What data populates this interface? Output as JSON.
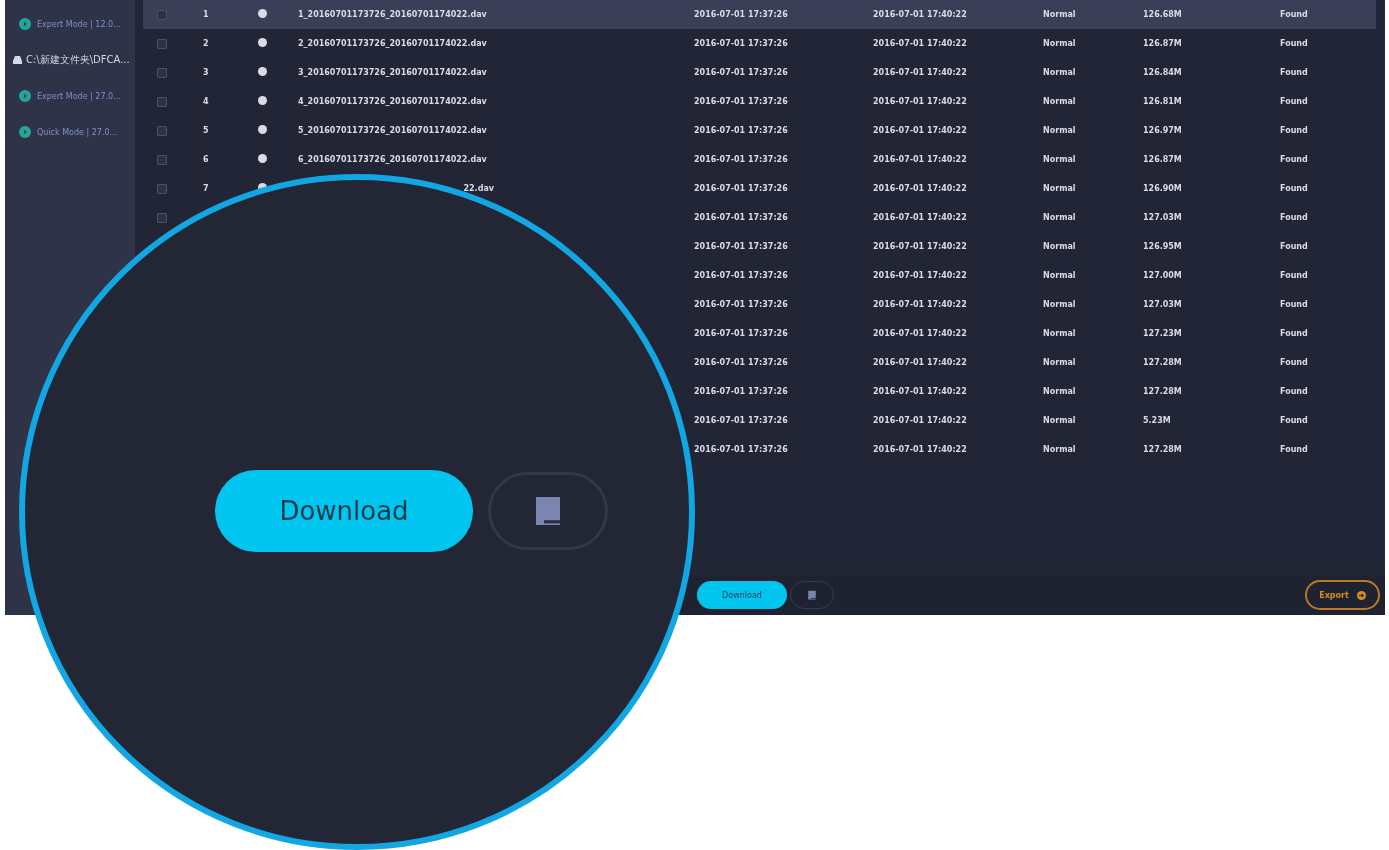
{
  "sidebar": {
    "items": [
      {
        "kind": "mode",
        "label": "Expert Mode | 12.0..."
      },
      {
        "kind": "drive",
        "label": "C:\\新建文件夹\\DFCA..."
      },
      {
        "kind": "mode",
        "label": "Expert Mode | 27.0..."
      },
      {
        "kind": "mode",
        "label": "Quick Mode | 27.0..."
      }
    ]
  },
  "table": {
    "rows": [
      {
        "selected": true,
        "checked": false,
        "number": "1",
        "name": "1_20160701173726_20160701174022.dav",
        "created": "2016-07-01 17:37:26",
        "modified": "2016-07-01 17:40:22",
        "type": "Normal",
        "size": "126.68M",
        "status": "Found"
      },
      {
        "selected": false,
        "checked": false,
        "number": "2",
        "name": "2_20160701173726_20160701174022.dav",
        "created": "2016-07-01 17:37:26",
        "modified": "2016-07-01 17:40:22",
        "type": "Normal",
        "size": "126.87M",
        "status": "Found"
      },
      {
        "selected": false,
        "checked": false,
        "number": "3",
        "name": "3_20160701173726_20160701174022.dav",
        "created": "2016-07-01 17:37:26",
        "modified": "2016-07-01 17:40:22",
        "type": "Normal",
        "size": "126.84M",
        "status": "Found"
      },
      {
        "selected": false,
        "checked": false,
        "number": "4",
        "name": "4_20160701173726_20160701174022.dav",
        "created": "2016-07-01 17:37:26",
        "modified": "2016-07-01 17:40:22",
        "type": "Normal",
        "size": "126.81M",
        "status": "Found"
      },
      {
        "selected": false,
        "checked": false,
        "number": "5",
        "name": "5_20160701173726_20160701174022.dav",
        "created": "2016-07-01 17:37:26",
        "modified": "2016-07-01 17:40:22",
        "type": "Normal",
        "size": "126.97M",
        "status": "Found"
      },
      {
        "selected": false,
        "checked": false,
        "number": "6",
        "name": "6_20160701173726_20160701174022.dav",
        "created": "2016-07-01 17:37:26",
        "modified": "2016-07-01 17:40:22",
        "type": "Normal",
        "size": "126.87M",
        "status": "Found"
      },
      {
        "selected": false,
        "checked": false,
        "number": "7",
        "name_tail": "22.dav",
        "created": "2016-07-01 17:37:26",
        "modified": "2016-07-01 17:40:22",
        "type": "Normal",
        "size": "126.90M",
        "status": "Found"
      },
      {
        "selected": false,
        "checked": false,
        "created": "2016-07-01 17:37:26",
        "modified": "2016-07-01 17:40:22",
        "type": "Normal",
        "size": "127.03M",
        "status": "Found"
      },
      {
        "selected": false,
        "created": "2016-07-01 17:37:26",
        "modified": "2016-07-01 17:40:22",
        "type": "Normal",
        "size": "126.95M",
        "status": "Found"
      },
      {
        "selected": false,
        "created": "2016-07-01 17:37:26",
        "modified": "2016-07-01 17:40:22",
        "type": "Normal",
        "size": "127.00M",
        "status": "Found"
      },
      {
        "selected": false,
        "created": "2016-07-01 17:37:26",
        "modified": "2016-07-01 17:40:22",
        "type": "Normal",
        "size": "127.03M",
        "status": "Found"
      },
      {
        "selected": false,
        "created": "2016-07-01 17:37:26",
        "modified": "2016-07-01 17:40:22",
        "type": "Normal",
        "size": "127.23M",
        "status": "Found"
      },
      {
        "selected": false,
        "created": "2016-07-01 17:37:26",
        "modified": "2016-07-01 17:40:22",
        "type": "Normal",
        "size": "127.28M",
        "status": "Found"
      },
      {
        "selected": false,
        "created": "2016-07-01 17:37:26",
        "modified": "2016-07-01 17:40:22",
        "type": "Normal",
        "size": "127.28M",
        "status": "Found"
      },
      {
        "selected": false,
        "created": "2016-07-01 17:37:26",
        "modified": "2016-07-01 17:40:22",
        "type": "Normal",
        "size": "5.23M",
        "status": "Found"
      },
      {
        "selected": false,
        "created": "2016-07-01 17:37:26",
        "modified": "2016-07-01 17:40:22",
        "type": "Normal",
        "size": "127.28M",
        "status": "Found"
      }
    ]
  },
  "footer": {
    "download": "Download",
    "export": "Export"
  },
  "lens": {
    "download": "Download"
  }
}
